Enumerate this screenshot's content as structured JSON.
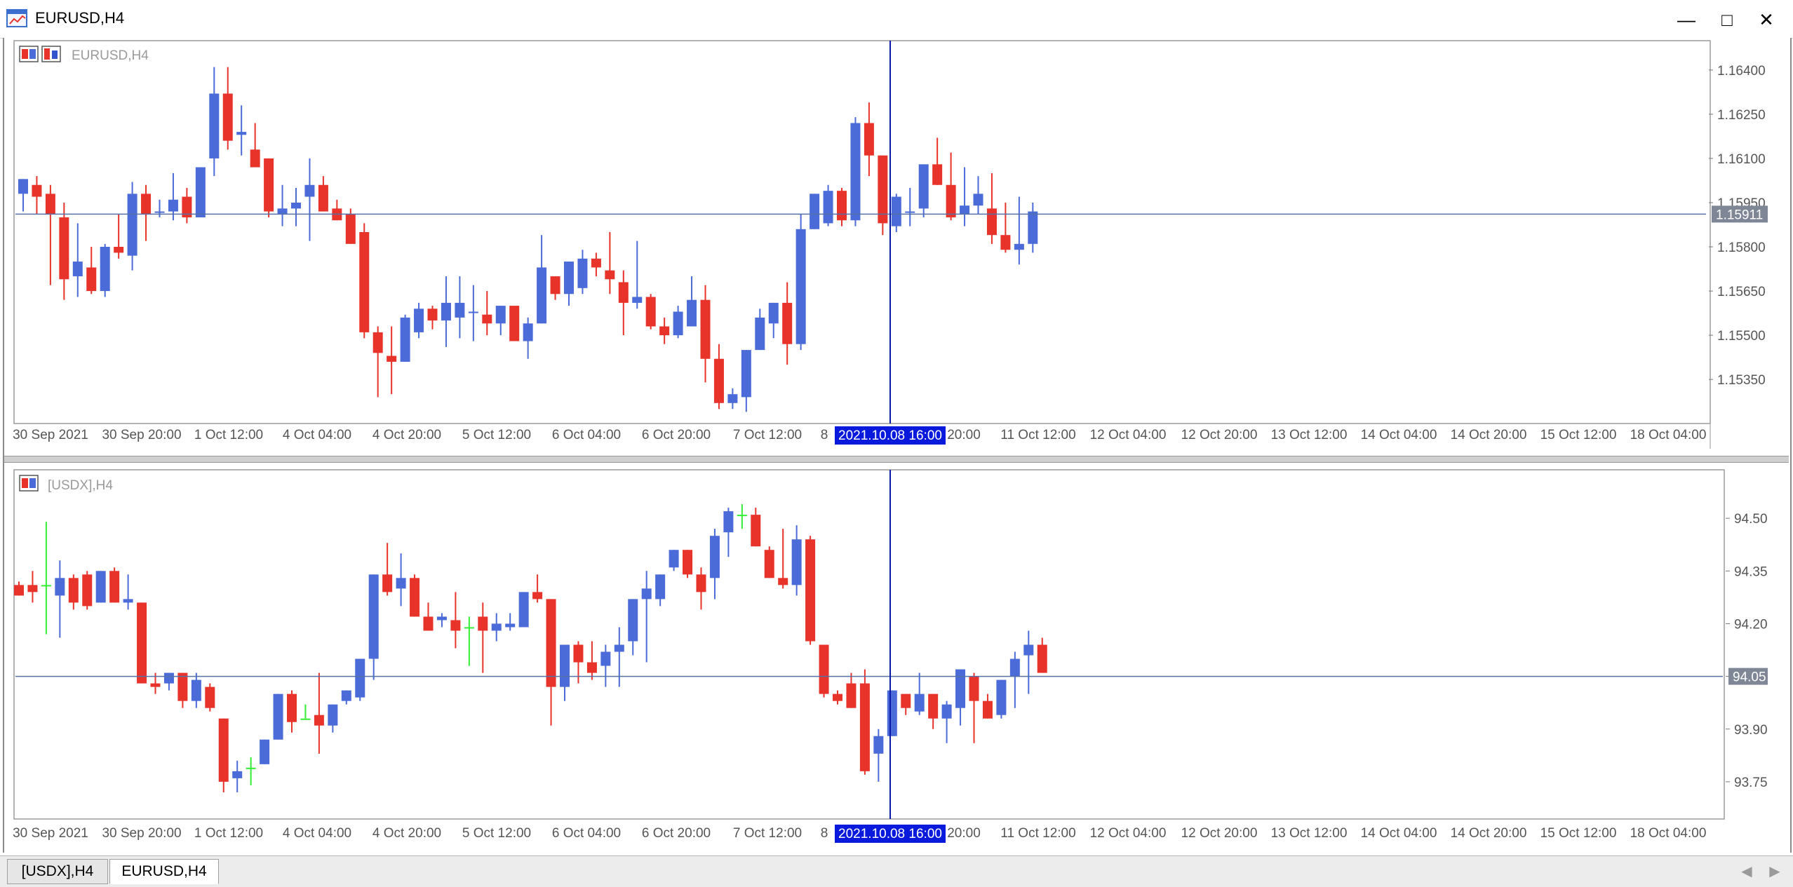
{
  "window": {
    "title": "EURUSD,H4",
    "minimize": "—",
    "maximize": "□",
    "close": "✕"
  },
  "tabs": [
    {
      "label": "[USDX],H4",
      "active": false
    },
    {
      "label": "EURUSD,H4",
      "active": true
    }
  ],
  "colors": {
    "bull": "#4a6bd8",
    "bear": "#e8332a",
    "crosshair": "#0a1aa8",
    "doji": "#33ee33",
    "grid": "#9aa4b8",
    "axis_text": "#555555"
  },
  "chart_data": [
    {
      "type": "candlestick",
      "title": "EURUSD,H4",
      "crosshair_label": "2021.10.08 16:00",
      "current_price_label": "1.15911",
      "current_price": 1.15911,
      "ylim": [
        1.1521,
        1.1649
      ],
      "y_ticks": [
        "1.16400",
        "1.16250",
        "1.16100",
        "1.15950",
        "1.15800",
        "1.15650",
        "1.15500",
        "1.15350"
      ],
      "x_ticks": [
        "30 Sep 2021",
        "30 Sep 20:00",
        "1 Oct 12:00",
        "4 Oct 04:00",
        "4 Oct 20:00",
        "5 Oct 12:00",
        "6 Oct 04:00",
        "6 Oct 20:00",
        "7 Oct 12:00",
        "8",
        "20:00",
        "11 Oct 12:00",
        "12 Oct 04:00",
        "12 Oct 20:00",
        "13 Oct 12:00",
        "14 Oct 04:00",
        "14 Oct 20:00",
        "15 Oct 12:00",
        "18 Oct 04:00"
      ],
      "candles": [
        {
          "o": 1.1598,
          "h": 1.1603,
          "l": 1.1592,
          "c": 1.1603
        },
        {
          "o": 1.1601,
          "h": 1.1604,
          "l": 1.1591,
          "c": 1.1597
        },
        {
          "o": 1.1598,
          "h": 1.1601,
          "l": 1.1567,
          "c": 1.1591
        },
        {
          "o": 1.159,
          "h": 1.1595,
          "l": 1.1562,
          "c": 1.1569
        },
        {
          "o": 1.157,
          "h": 1.1588,
          "l": 1.1563,
          "c": 1.1575
        },
        {
          "o": 1.1573,
          "h": 1.158,
          "l": 1.1564,
          "c": 1.1565
        },
        {
          "o": 1.1565,
          "h": 1.1581,
          "l": 1.1563,
          "c": 1.158
        },
        {
          "o": 1.158,
          "h": 1.1591,
          "l": 1.1576,
          "c": 1.1578
        },
        {
          "o": 1.1577,
          "h": 1.1602,
          "l": 1.1572,
          "c": 1.1598
        },
        {
          "o": 1.1598,
          "h": 1.1601,
          "l": 1.1582,
          "c": 1.1591
        },
        {
          "o": 1.1592,
          "h": 1.1596,
          "l": 1.159,
          "c": 1.1592
        },
        {
          "o": 1.1592,
          "h": 1.1605,
          "l": 1.1589,
          "c": 1.1596
        },
        {
          "o": 1.1597,
          "h": 1.16,
          "l": 1.1588,
          "c": 1.159
        },
        {
          "o": 1.159,
          "h": 1.1607,
          "l": 1.159,
          "c": 1.1607
        },
        {
          "o": 1.161,
          "h": 1.1641,
          "l": 1.1604,
          "c": 1.1632
        },
        {
          "o": 1.1632,
          "h": 1.1641,
          "l": 1.1613,
          "c": 1.1616
        },
        {
          "o": 1.1618,
          "h": 1.1628,
          "l": 1.1611,
          "c": 1.1619
        },
        {
          "o": 1.1613,
          "h": 1.1622,
          "l": 1.1607,
          "c": 1.1607
        },
        {
          "o": 1.161,
          "h": 1.1606,
          "l": 1.159,
          "c": 1.1592
        },
        {
          "o": 1.1591,
          "h": 1.1601,
          "l": 1.1587,
          "c": 1.1593
        },
        {
          "o": 1.1593,
          "h": 1.16,
          "l": 1.1587,
          "c": 1.1595
        },
        {
          "o": 1.1597,
          "h": 1.161,
          "l": 1.1582,
          "c": 1.1601
        },
        {
          "o": 1.1601,
          "h": 1.1604,
          "l": 1.1592,
          "c": 1.1592
        },
        {
          "o": 1.1593,
          "h": 1.1596,
          "l": 1.159,
          "c": 1.1589
        },
        {
          "o": 1.1591,
          "h": 1.1593,
          "l": 1.1584,
          "c": 1.1581
        },
        {
          "o": 1.1585,
          "h": 1.1588,
          "l": 1.1549,
          "c": 1.1551
        },
        {
          "o": 1.1551,
          "h": 1.1553,
          "l": 1.1529,
          "c": 1.1544
        },
        {
          "o": 1.1543,
          "h": 1.1553,
          "l": 1.153,
          "c": 1.1541
        },
        {
          "o": 1.1541,
          "h": 1.1557,
          "l": 1.1541,
          "c": 1.1556
        },
        {
          "o": 1.1551,
          "h": 1.1561,
          "l": 1.1549,
          "c": 1.1559
        },
        {
          "o": 1.1559,
          "h": 1.156,
          "l": 1.1552,
          "c": 1.1555
        },
        {
          "o": 1.1555,
          "h": 1.157,
          "l": 1.1546,
          "c": 1.1561
        },
        {
          "o": 1.1556,
          "h": 1.157,
          "l": 1.1549,
          "c": 1.1561
        },
        {
          "o": 1.1558,
          "h": 1.1567,
          "l": 1.1548,
          "c": 1.1558
        },
        {
          "o": 1.1557,
          "h": 1.1565,
          "l": 1.155,
          "c": 1.1554
        },
        {
          "o": 1.1554,
          "h": 1.1559,
          "l": 1.155,
          "c": 1.156
        },
        {
          "o": 1.156,
          "h": 1.156,
          "l": 1.1549,
          "c": 1.1548
        },
        {
          "o": 1.1548,
          "h": 1.1556,
          "l": 1.1542,
          "c": 1.1554
        },
        {
          "o": 1.1554,
          "h": 1.1584,
          "l": 1.1554,
          "c": 1.1573
        },
        {
          "o": 1.157,
          "h": 1.157,
          "l": 1.1562,
          "c": 1.1564
        },
        {
          "o": 1.1564,
          "h": 1.1575,
          "l": 1.156,
          "c": 1.1575
        },
        {
          "o": 1.1566,
          "h": 1.1579,
          "l": 1.1564,
          "c": 1.1576
        },
        {
          "o": 1.1576,
          "h": 1.1578,
          "l": 1.157,
          "c": 1.1573
        },
        {
          "o": 1.1572,
          "h": 1.1585,
          "l": 1.1564,
          "c": 1.1569
        },
        {
          "o": 1.1568,
          "h": 1.1572,
          "l": 1.155,
          "c": 1.1561
        },
        {
          "o": 1.1561,
          "h": 1.1582,
          "l": 1.1559,
          "c": 1.1563
        },
        {
          "o": 1.1563,
          "h": 1.1564,
          "l": 1.1552,
          "c": 1.1553
        },
        {
          "o": 1.1553,
          "h": 1.1556,
          "l": 1.1547,
          "c": 1.155
        },
        {
          "o": 1.155,
          "h": 1.156,
          "l": 1.1549,
          "c": 1.1558
        },
        {
          "o": 1.1553,
          "h": 1.157,
          "l": 1.1553,
          "c": 1.1562
        },
        {
          "o": 1.1562,
          "h": 1.1567,
          "l": 1.1534,
          "c": 1.1542
        },
        {
          "o": 1.1542,
          "h": 1.1547,
          "l": 1.1525,
          "c": 1.1527
        },
        {
          "o": 1.1527,
          "h": 1.1532,
          "l": 1.1525,
          "c": 1.153
        },
        {
          "o": 1.1529,
          "h": 1.1545,
          "l": 1.1524,
          "c": 1.1545
        },
        {
          "o": 1.1545,
          "h": 1.1559,
          "l": 1.1545,
          "c": 1.1556
        },
        {
          "o": 1.1554,
          "h": 1.1561,
          "l": 1.1549,
          "c": 1.1561
        },
        {
          "o": 1.1561,
          "h": 1.1568,
          "l": 1.154,
          "c": 1.1547
        },
        {
          "o": 1.1547,
          "h": 1.1591,
          "l": 1.1545,
          "c": 1.1586
        },
        {
          "o": 1.1586,
          "h": 1.1598,
          "l": 1.1586,
          "c": 1.1598
        },
        {
          "o": 1.1588,
          "h": 1.1601,
          "l": 1.1587,
          "c": 1.1599
        },
        {
          "o": 1.1599,
          "h": 1.16,
          "l": 1.1587,
          "c": 1.1589
        },
        {
          "o": 1.1589,
          "h": 1.1624,
          "l": 1.1587,
          "c": 1.1622
        },
        {
          "o": 1.1622,
          "h": 1.1629,
          "l": 1.1604,
          "c": 1.1611
        },
        {
          "o": 1.1611,
          "h": 1.1611,
          "l": 1.1584,
          "c": 1.1588
        },
        {
          "o": 1.1587,
          "h": 1.1598,
          "l": 1.1585,
          "c": 1.1597
        },
        {
          "o": 1.1592,
          "h": 1.16,
          "l": 1.1587,
          "c": 1.1592
        },
        {
          "o": 1.1593,
          "h": 1.1608,
          "l": 1.159,
          "c": 1.1608
        },
        {
          "o": 1.1608,
          "h": 1.1617,
          "l": 1.1601,
          "c": 1.1601
        },
        {
          "o": 1.1601,
          "h": 1.1612,
          "l": 1.1589,
          "c": 1.159
        },
        {
          "o": 1.1591,
          "h": 1.1607,
          "l": 1.1587,
          "c": 1.1594
        },
        {
          "o": 1.1594,
          "h": 1.1604,
          "l": 1.1591,
          "c": 1.1598
        },
        {
          "o": 1.1593,
          "h": 1.1605,
          "l": 1.1581,
          "c": 1.1584
        },
        {
          "o": 1.1584,
          "h": 1.1595,
          "l": 1.1578,
          "c": 1.1579
        },
        {
          "o": 1.1579,
          "h": 1.1597,
          "l": 1.1574,
          "c": 1.1581
        },
        {
          "o": 1.1581,
          "h": 1.1595,
          "l": 1.1578,
          "c": 1.1592
        }
      ]
    },
    {
      "type": "candlestick",
      "title": "[USDX],H4",
      "crosshair_label": "2021.10.08 16:00",
      "current_price_label": "94.05",
      "current_price": 94.05,
      "ylim": [
        93.66,
        94.63
      ],
      "y_ticks": [
        "94.50",
        "94.35",
        "94.20",
        "94.05",
        "93.90",
        "93.75"
      ],
      "x_ticks": [
        "30 Sep 2021",
        "30 Sep 20:00",
        "1 Oct 12:00",
        "4 Oct 04:00",
        "4 Oct 20:00",
        "5 Oct 12:00",
        "6 Oct 04:00",
        "6 Oct 20:00",
        "7 Oct 12:00",
        "8",
        "20:00",
        "11 Oct 12:00",
        "12 Oct 04:00",
        "12 Oct 20:00",
        "13 Oct 12:00",
        "14 Oct 04:00",
        "14 Oct 20:00",
        "15 Oct 12:00",
        "18 Oct 04:00"
      ],
      "candles": [
        {
          "o": 94.31,
          "h": 94.32,
          "l": 94.29,
          "c": 94.28
        },
        {
          "o": 94.31,
          "h": 94.35,
          "l": 94.26,
          "c": 94.29
        },
        {
          "o": 94.31,
          "h": 94.49,
          "l": 94.17,
          "c": 94.31
        },
        {
          "o": 94.28,
          "h": 94.38,
          "l": 94.16,
          "c": 94.33
        },
        {
          "o": 94.33,
          "h": 94.34,
          "l": 94.24,
          "c": 94.26
        },
        {
          "o": 94.34,
          "h": 94.35,
          "l": 94.24,
          "c": 94.25
        },
        {
          "o": 94.26,
          "h": 94.35,
          "l": 94.27,
          "c": 94.35
        },
        {
          "o": 94.35,
          "h": 94.36,
          "l": 94.26,
          "c": 94.26
        },
        {
          "o": 94.26,
          "h": 94.34,
          "l": 94.24,
          "c": 94.27
        },
        {
          "o": 94.26,
          "h": 94.26,
          "l": 94.03,
          "c": 94.03
        },
        {
          "o": 94.03,
          "h": 94.06,
          "l": 94.0,
          "c": 94.02
        },
        {
          "o": 94.03,
          "h": 94.06,
          "l": 94.01,
          "c": 94.06
        },
        {
          "o": 94.06,
          "h": 94.06,
          "l": 93.96,
          "c": 93.98
        },
        {
          "o": 93.98,
          "h": 94.06,
          "l": 93.96,
          "c": 94.04
        },
        {
          "o": 94.02,
          "h": 94.03,
          "l": 93.95,
          "c": 93.96
        },
        {
          "o": 93.93,
          "h": 93.92,
          "l": 93.72,
          "c": 93.75
        },
        {
          "o": 93.76,
          "h": 93.81,
          "l": 93.72,
          "c": 93.78
        },
        {
          "o": 93.79,
          "h": 93.82,
          "l": 93.74,
          "c": 93.79
        },
        {
          "o": 93.8,
          "h": 93.87,
          "l": 93.8,
          "c": 93.87
        },
        {
          "o": 93.87,
          "h": 94.0,
          "l": 93.87,
          "c": 94.0
        },
        {
          "o": 94.0,
          "h": 94.01,
          "l": 93.89,
          "c": 93.92
        },
        {
          "o": 93.93,
          "h": 93.97,
          "l": 93.93,
          "c": 93.93
        },
        {
          "o": 93.94,
          "h": 94.06,
          "l": 93.83,
          "c": 93.91
        },
        {
          "o": 93.91,
          "h": 93.97,
          "l": 93.89,
          "c": 93.97
        },
        {
          "o": 93.98,
          "h": 94.0,
          "l": 93.97,
          "c": 94.01
        },
        {
          "o": 93.99,
          "h": 94.1,
          "l": 93.98,
          "c": 94.1
        },
        {
          "o": 94.1,
          "h": 94.34,
          "l": 94.04,
          "c": 94.34
        },
        {
          "o": 94.34,
          "h": 94.43,
          "l": 94.28,
          "c": 94.29
        },
        {
          "o": 94.3,
          "h": 94.4,
          "l": 94.25,
          "c": 94.33
        },
        {
          "o": 94.33,
          "h": 94.34,
          "l": 94.22,
          "c": 94.22
        },
        {
          "o": 94.22,
          "h": 94.26,
          "l": 94.18,
          "c": 94.18
        },
        {
          "o": 94.21,
          "h": 94.23,
          "l": 94.19,
          "c": 94.22
        },
        {
          "o": 94.21,
          "h": 94.29,
          "l": 94.13,
          "c": 94.18
        },
        {
          "o": 94.19,
          "h": 94.22,
          "l": 94.08,
          "c": 94.19
        },
        {
          "o": 94.22,
          "h": 94.26,
          "l": 94.06,
          "c": 94.18
        },
        {
          "o": 94.18,
          "h": 94.23,
          "l": 94.15,
          "c": 94.2
        },
        {
          "o": 94.19,
          "h": 94.23,
          "l": 94.18,
          "c": 94.2
        },
        {
          "o": 94.19,
          "h": 94.29,
          "l": 94.19,
          "c": 94.29
        },
        {
          "o": 94.29,
          "h": 94.34,
          "l": 94.26,
          "c": 94.27
        },
        {
          "o": 94.27,
          "h": 94.27,
          "l": 93.91,
          "c": 94.02
        },
        {
          "o": 94.02,
          "h": 94.13,
          "l": 93.98,
          "c": 94.14
        },
        {
          "o": 94.14,
          "h": 94.15,
          "l": 94.03,
          "c": 94.09
        },
        {
          "o": 94.09,
          "h": 94.15,
          "l": 94.04,
          "c": 94.06
        },
        {
          "o": 94.08,
          "h": 94.14,
          "l": 94.02,
          "c": 94.12
        },
        {
          "o": 94.12,
          "h": 94.19,
          "l": 94.02,
          "c": 94.14
        },
        {
          "o": 94.15,
          "h": 94.26,
          "l": 94.11,
          "c": 94.27
        },
        {
          "o": 94.27,
          "h": 94.35,
          "l": 94.09,
          "c": 94.3
        },
        {
          "o": 94.27,
          "h": 94.34,
          "l": 94.25,
          "c": 94.34
        },
        {
          "o": 94.36,
          "h": 94.41,
          "l": 94.35,
          "c": 94.41
        },
        {
          "o": 94.41,
          "h": 94.41,
          "l": 94.33,
          "c": 94.34
        },
        {
          "o": 94.34,
          "h": 94.36,
          "l": 94.24,
          "c": 94.29
        },
        {
          "o": 94.33,
          "h": 94.47,
          "l": 94.27,
          "c": 94.45
        },
        {
          "o": 94.46,
          "h": 94.53,
          "l": 94.39,
          "c": 94.52
        },
        {
          "o": 94.51,
          "h": 94.54,
          "l": 94.47,
          "c": 94.51
        },
        {
          "o": 94.51,
          "h": 94.53,
          "l": 94.42,
          "c": 94.42
        },
        {
          "o": 94.41,
          "h": 94.42,
          "l": 94.33,
          "c": 94.33
        },
        {
          "o": 94.33,
          "h": 94.47,
          "l": 94.3,
          "c": 94.31
        },
        {
          "o": 94.31,
          "h": 94.48,
          "l": 94.28,
          "c": 94.44
        },
        {
          "o": 94.44,
          "h": 94.45,
          "l": 94.14,
          "c": 94.15
        },
        {
          "o": 94.14,
          "h": 94.14,
          "l": 93.99,
          "c": 94.0
        },
        {
          "o": 94.0,
          "h": 94.01,
          "l": 93.97,
          "c": 93.98
        },
        {
          "o": 94.03,
          "h": 94.06,
          "l": 93.97,
          "c": 93.96
        },
        {
          "o": 94.03,
          "h": 94.07,
          "l": 93.77,
          "c": 93.78
        },
        {
          "o": 93.83,
          "h": 93.9,
          "l": 93.75,
          "c": 93.88
        },
        {
          "o": 93.88,
          "h": 94.01,
          "l": 93.88,
          "c": 94.01
        },
        {
          "o": 94.0,
          "h": 94.0,
          "l": 93.94,
          "c": 93.96
        },
        {
          "o": 93.95,
          "h": 94.06,
          "l": 93.94,
          "c": 94.0
        },
        {
          "o": 94.0,
          "h": 94.0,
          "l": 93.9,
          "c": 93.93
        },
        {
          "o": 93.93,
          "h": 93.98,
          "l": 93.86,
          "c": 93.97
        },
        {
          "o": 93.96,
          "h": 94.07,
          "l": 93.91,
          "c": 94.07
        },
        {
          "o": 94.05,
          "h": 94.06,
          "l": 93.86,
          "c": 93.98
        },
        {
          "o": 93.98,
          "h": 94.0,
          "l": 93.93,
          "c": 93.93
        },
        {
          "o": 93.94,
          "h": 94.02,
          "l": 93.93,
          "c": 94.04
        },
        {
          "o": 94.05,
          "h": 94.12,
          "l": 93.96,
          "c": 94.1
        },
        {
          "o": 94.11,
          "h": 94.18,
          "l": 94.0,
          "c": 94.14
        },
        {
          "o": 94.14,
          "h": 94.16,
          "l": 94.06,
          "c": 94.06
        }
      ]
    }
  ]
}
